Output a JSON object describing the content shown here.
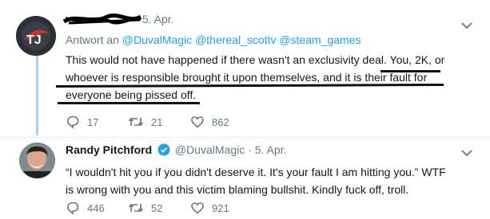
{
  "tweet1": {
    "date": "5. Apr.",
    "reply_prefix": "Antwort an",
    "mentions": [
      "@DuvalMagic",
      "@thereal_scottv",
      "@steam_games"
    ],
    "text_line1": "This would not have happened if there wasn't an exclusivity deal. You, 2K, or",
    "text_line2": "whoever is responsible brought it upon themselves, and it is their fault for",
    "text_line3": "everyone being pissed off.",
    "replies": "17",
    "retweets": "21",
    "likes": "862",
    "avatar_logo_text": "TJ"
  },
  "tweet2": {
    "name": "Randy Pitchford",
    "handle": "@DuvalMagic",
    "separator": "·",
    "date": "5. Apr.",
    "text_line1": "“I wouldn't hit you if you didn't deserve it.  It's your fault I am hitting you.”  WTF",
    "text_line2": "is wrong with you and this victim blaming bullshit.  Kindly fuck off, troll.",
    "replies": "446",
    "retweets": "52",
    "likes": "921"
  },
  "colors": {
    "link": "#1da1f2",
    "muted": "#657786",
    "thread_line": "#a8d4f2",
    "verified": "#1da1f2"
  }
}
